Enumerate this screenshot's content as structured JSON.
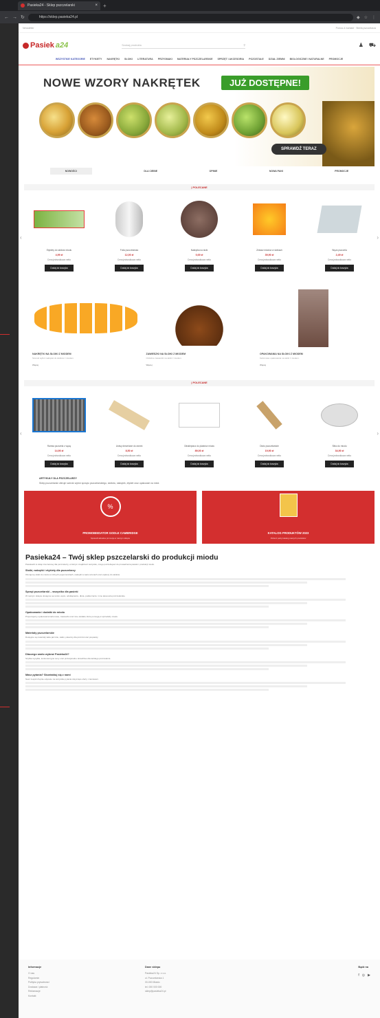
{
  "browser": {
    "tab_title": "Pasieka24 - Sklep pszczelarski",
    "url": "https://sklep.pasieka24.pl",
    "new_tab": "+"
  },
  "topline": {
    "left": "Newsletter",
    "right": "Pomoc & kontakt  ·  Strefa pszczelarza"
  },
  "logo": {
    "text_red": "Pasiek",
    "text_green": "a24"
  },
  "search": {
    "placeholder": "Szukaj produktu"
  },
  "nav": {
    "items": [
      "WSZYSTKIE KATEGORIE",
      "ETYKIETY",
      "NAKRĘTKI",
      "SŁOIKI",
      "LITERATURA",
      "PRZYSMAKI",
      "MATERIAŁY PSZCZELARSKIE",
      "SPRZĘT I AKCESORIA",
      "POZOSTAŁE",
      "DZIAŁ ZIEMNI",
      "BIOLOGICZNE I NATURALNE",
      "PROMOCJE"
    ]
  },
  "banner": {
    "title": "NOWE WZORY NAKRĘTEK",
    "badge": "JUŻ DOSTĘPNE!",
    "cta": "SPRAWDŹ TERAZ"
  },
  "tabs": [
    "NOWOŚCI",
    "DLA CIEBIE",
    "OPINIE",
    "NOWA PANI",
    "PROMOCJE"
  ],
  "sections": {
    "recommended": "| POLECANE",
    "popular": "| POLECANE"
  },
  "products_a": [
    {
      "title": "Etykiety do słoików miodu",
      "price": "4,99 zł",
      "net": "Cena jednostkowa netto",
      "btn": "Dodaj do koszyka"
    },
    {
      "title": "Folia pszczelarska",
      "price": "12,00 zł",
      "net": "Cena jednostkowa netto",
      "btn": "Dodaj do koszyka"
    },
    {
      "title": "Nakrętka na słoik",
      "price": "0,69 zł",
      "net": "Cena jednostkowa netto",
      "btn": "Dodaj do koszyka"
    },
    {
      "title": "Zestaw miodów w słoikach",
      "price": "39,90 zł",
      "net": "Cena jednostkowa netto",
      "btn": "Dodaj do koszyka"
    },
    {
      "title": "Węza pszczela",
      "price": "2,49 zł",
      "net": "Cena jednostkowa netto",
      "btn": "Dodaj do koszyka"
    }
  ],
  "categories": [
    {
      "title": "NAKRĘTKI NA SŁOIKI Z MIODEM",
      "desc": "Szeroki wybór nakrętek do słoików z miodem.",
      "more": "Więcej"
    },
    {
      "title": "ZAWIESZKI NA SŁOIKI Z MIODEM",
      "desc": "Ozdobne zawieszki na słoiki z miodem.",
      "more": "Więcej"
    },
    {
      "title": "OPAKOWANIA NA SŁOIKI Z MIODEM",
      "desc": "Kartonowe opakowania na słoiki z miodem.",
      "more": "Więcej"
    }
  ],
  "products_b": [
    {
      "title": "Ramka pszczela z węzą",
      "price": "14,90 zł",
      "net": "Cena jednostkowa netto",
      "btn": "Dodaj do koszyka"
    },
    {
      "title": "Listwy drewniane do ramek",
      "price": "8,50 zł",
      "net": "Cena jednostkowa netto",
      "btn": "Dodaj do koszyka"
    },
    {
      "title": "Odsklepiacz do plastrów miodu",
      "price": "89,00 zł",
      "net": "Cena jednostkowa netto",
      "btn": "Dodaj do koszyka"
    },
    {
      "title": "Dłuto pszczelarskie",
      "price": "19,90 zł",
      "net": "Cena jednostkowa netto",
      "btn": "Dodaj do koszyka"
    },
    {
      "title": "Sitko do miodu",
      "price": "34,90 zł",
      "net": "Cena jednostkowa netto",
      "btn": "Dodaj do koszyka"
    }
  ],
  "about": {
    "title": "ARTYKUŁY DLA PSZCZELARZY",
    "text": "Sklep pszczelarski oferuje szeroki wybór sprzętu pszczelarskiego, słoików, nakrętek, etykiet oraz opakowań na miód."
  },
  "promos": [
    {
      "title": "PROMOBIEDATOR GODLE CAMBRIDGE",
      "sub": "Sprawdź aktualne promocje w naszym sklepie",
      "icon": "percent-icon"
    },
    {
      "title": "KATALOG PRODUKTÓW 2023",
      "sub": "Pobierz pełny katalog naszych produktów",
      "icon": "catalog-icon"
    }
  ],
  "seo": {
    "h2": "Pasieka24 – Twój sklep pszczelarski do produkcji miodu",
    "intro": "Pasieka24 to sklep internetowy dla pszczelarzy, w którym znajdziesz wszystko, czego potrzebujesz do prowadzenia pasieki i produkcji miodu.",
    "blocks": [
      {
        "h": "Słoiki, nakrętki i etykiety dla pszczelarzy",
        "p": "Oferujemy słoiki do miodu w różnych pojemnościach, nakrętki w wielu wzorach oraz etykiety do słoików."
      },
      {
        "h": "Sprzęt pszczelarski – wszystko dla pasieki",
        "p": "W naszym sklepie dostępne są ramki, węza, odsklepiacze, dłuta, podkurzacze i inne akcesoria pszczelarskie."
      },
      {
        "h": "Opakowania i dodatki do miodu",
        "p": "Proponujemy opakowania kartonowe, zawieszki oraz inne dodatki, które pomogą w sprzedaży miodu."
      },
      {
        "h": "Materiały pszczelarskie",
        "p": "Dostępne są materiały takie jak folie, siatki, pokarmy dla pszczół oraz preparaty."
      },
      {
        "h": "Dlaczego warto wybrać Pasieka24?",
        "p": "Szybka wysyłka, konkurencyjne ceny oraz profesjonalne doradztwo dla każdego pszczelarza."
      },
      {
        "h": "Masz pytania? Skontaktuj się z nami",
        "p": "Nasz zespół chętnie odpowie na wszystkie pytania dotyczące oferty i zamówień."
      }
    ]
  },
  "footer": {
    "col1_title": "Informacje",
    "col1": [
      "O nas",
      "Regulamin",
      "Polityka prywatności",
      "Dostawa i płatność",
      "Reklamacje",
      "Kontakt"
    ],
    "col2_title": "Dane sklepu",
    "col2": [
      "Pasieka24 Sp. z o.o.",
      "ul. Pszczelarska 1",
      "00-000 Miasto",
      "tel. 000 000 000",
      "sklep@pasieka24.pl"
    ],
    "social_title": "Bądź na",
    "social_icons": [
      "facebook-icon",
      "instagram-icon",
      "youtube-icon"
    ]
  }
}
